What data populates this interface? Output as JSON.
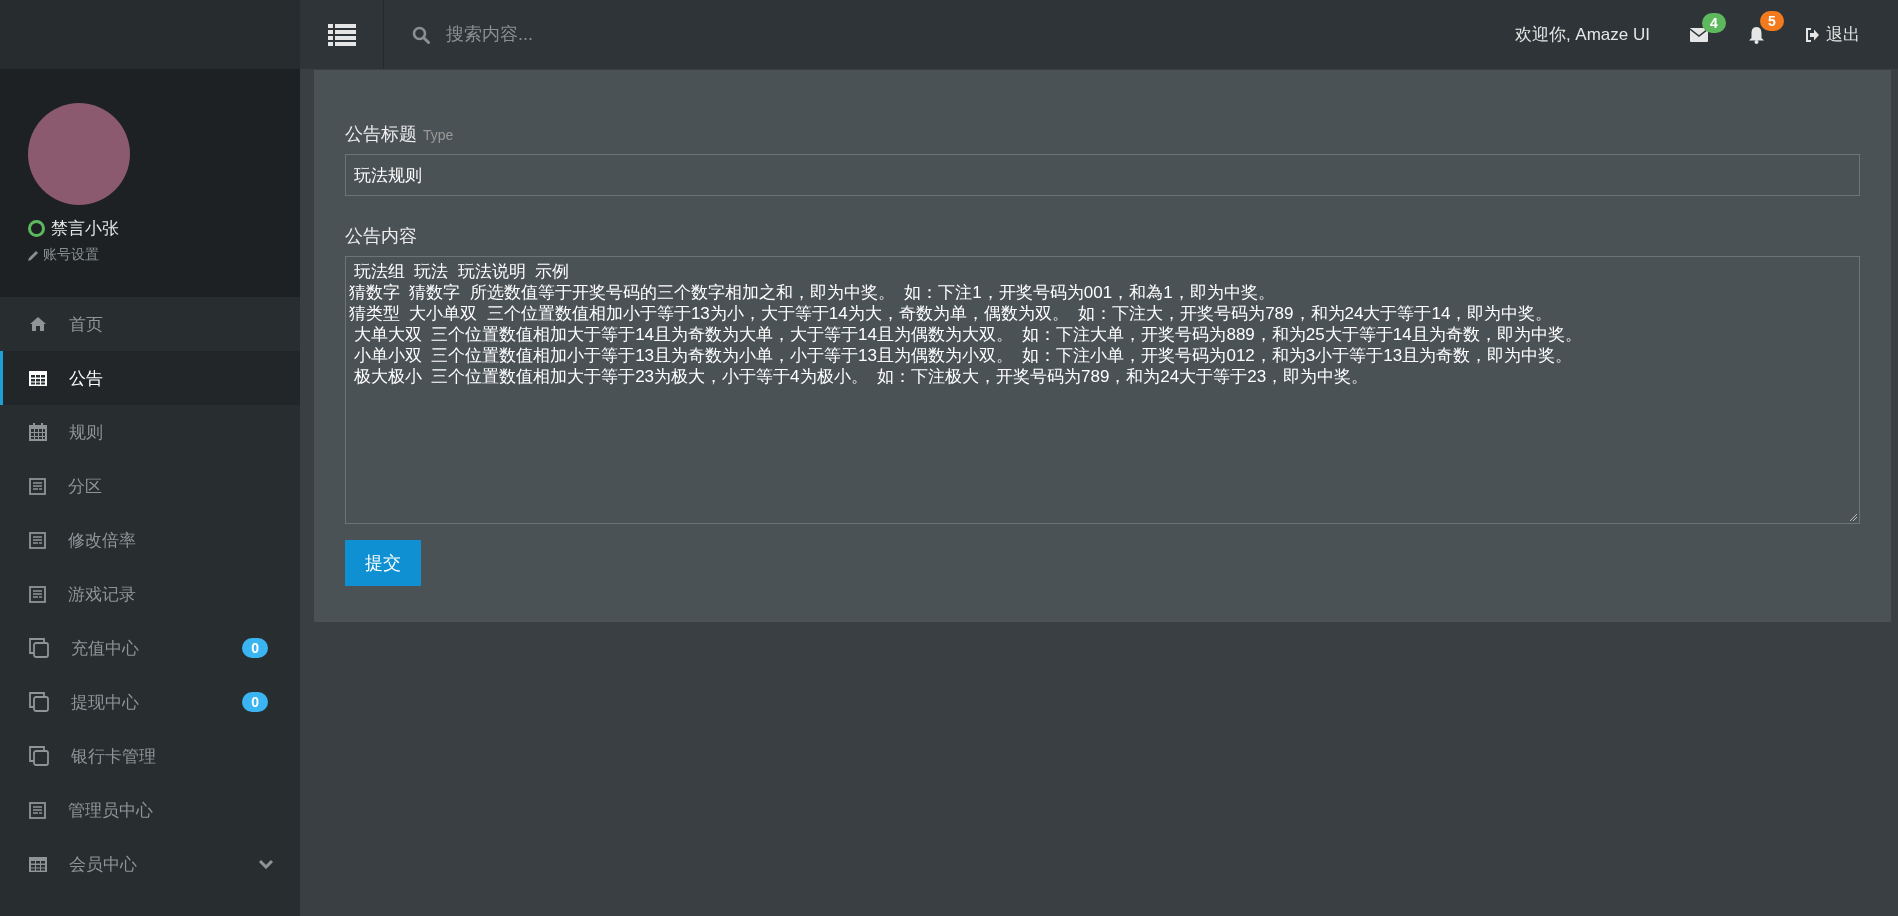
{
  "header": {
    "search": {
      "placeholder": "搜索内容..."
    },
    "welcome": "欢迎你, Amaze UI",
    "messages_badge": "4",
    "notifications_badge": "5",
    "logout": "退出"
  },
  "profile": {
    "name": "禁言小张",
    "online": true,
    "settings_link": "账号设置"
  },
  "sidebar": {
    "items": [
      {
        "label": "首页",
        "kind": "home",
        "selected": false
      },
      {
        "label": "公告",
        "kind": "table",
        "selected": true
      },
      {
        "label": "规则",
        "kind": "calendar",
        "selected": false
      },
      {
        "label": "分区",
        "kind": "note",
        "selected": false
      },
      {
        "label": "修改倍率",
        "kind": "note",
        "selected": false
      },
      {
        "label": "游戏记录",
        "kind": "note",
        "selected": false
      },
      {
        "label": "充值中心",
        "kind": "copy",
        "selected": false,
        "badge": "0"
      },
      {
        "label": "提现中心",
        "kind": "copy",
        "selected": false,
        "badge": "0"
      },
      {
        "label": "银行卡管理",
        "kind": "copy",
        "selected": false
      },
      {
        "label": "管理员中心",
        "kind": "note",
        "selected": false
      },
      {
        "label": "会员中心",
        "kind": "table",
        "selected": false,
        "expanded": false
      }
    ]
  },
  "form": {
    "title_label": "公告标题",
    "title_hint": "Type",
    "title_value": "玩法规则",
    "content_label": "公告内容",
    "content_lines": [
      " 玩法组  玩法  玩法说明  示例",
      "猜数字  猜数字  所选数值等于开奖号码的三个数字相加之和，即为中奖。  如：下注1，开奖号码为001，和為1，即为中奖。",
      "猜类型  大小单双  三个位置数值相加小于等于13为小，大于等于14为大，奇数为单，偶数为双。  如：下注大，开奖号码为789，和为24大于等于14，即为中奖。",
      " 大单大双  三个位置数值相加大于等于14且为奇数为大单，大于等于14且为偶数为大双。  如：下注大单，开奖号码为889，和为25大于等于14且为奇数，即为中奖。",
      " 小单小双  三个位置数值相加小于等于13且为奇数为小单，小于等于13且为偶数为小双。  如：下注小单，开奖号码为012，和为3小于等于13且为奇数，即为中奖。",
      " 极大极小  三个位置数值相加大于等于23为极大，小于等于4为极小。  如：下注极大，开奖号码为789，和为24大于等于23，即为中奖。"
    ],
    "submit": "提交"
  }
}
